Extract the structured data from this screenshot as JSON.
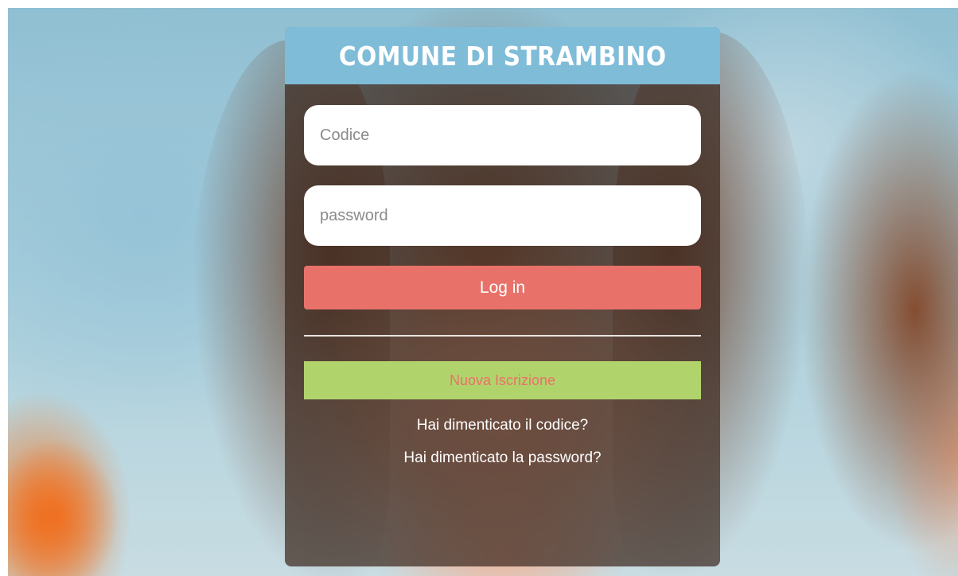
{
  "header": {
    "title": "COMUNE DI STRAMBINO"
  },
  "form": {
    "codice_placeholder": "Codice",
    "codice_value": "",
    "password_placeholder": "password",
    "password_value": "",
    "login_label": "Log in",
    "register_label": "Nuova Iscrizione",
    "forgot_code_label": "Hai dimenticato il codice?",
    "forgot_password_label": "Hai dimenticato la password?"
  },
  "colors": {
    "header_bg": "#7fbcd8",
    "login_button": "#e8726a",
    "register_button": "#b1d36b",
    "register_text": "#e8726a",
    "card_bg": "rgba(60, 40, 30, 0.72)"
  }
}
